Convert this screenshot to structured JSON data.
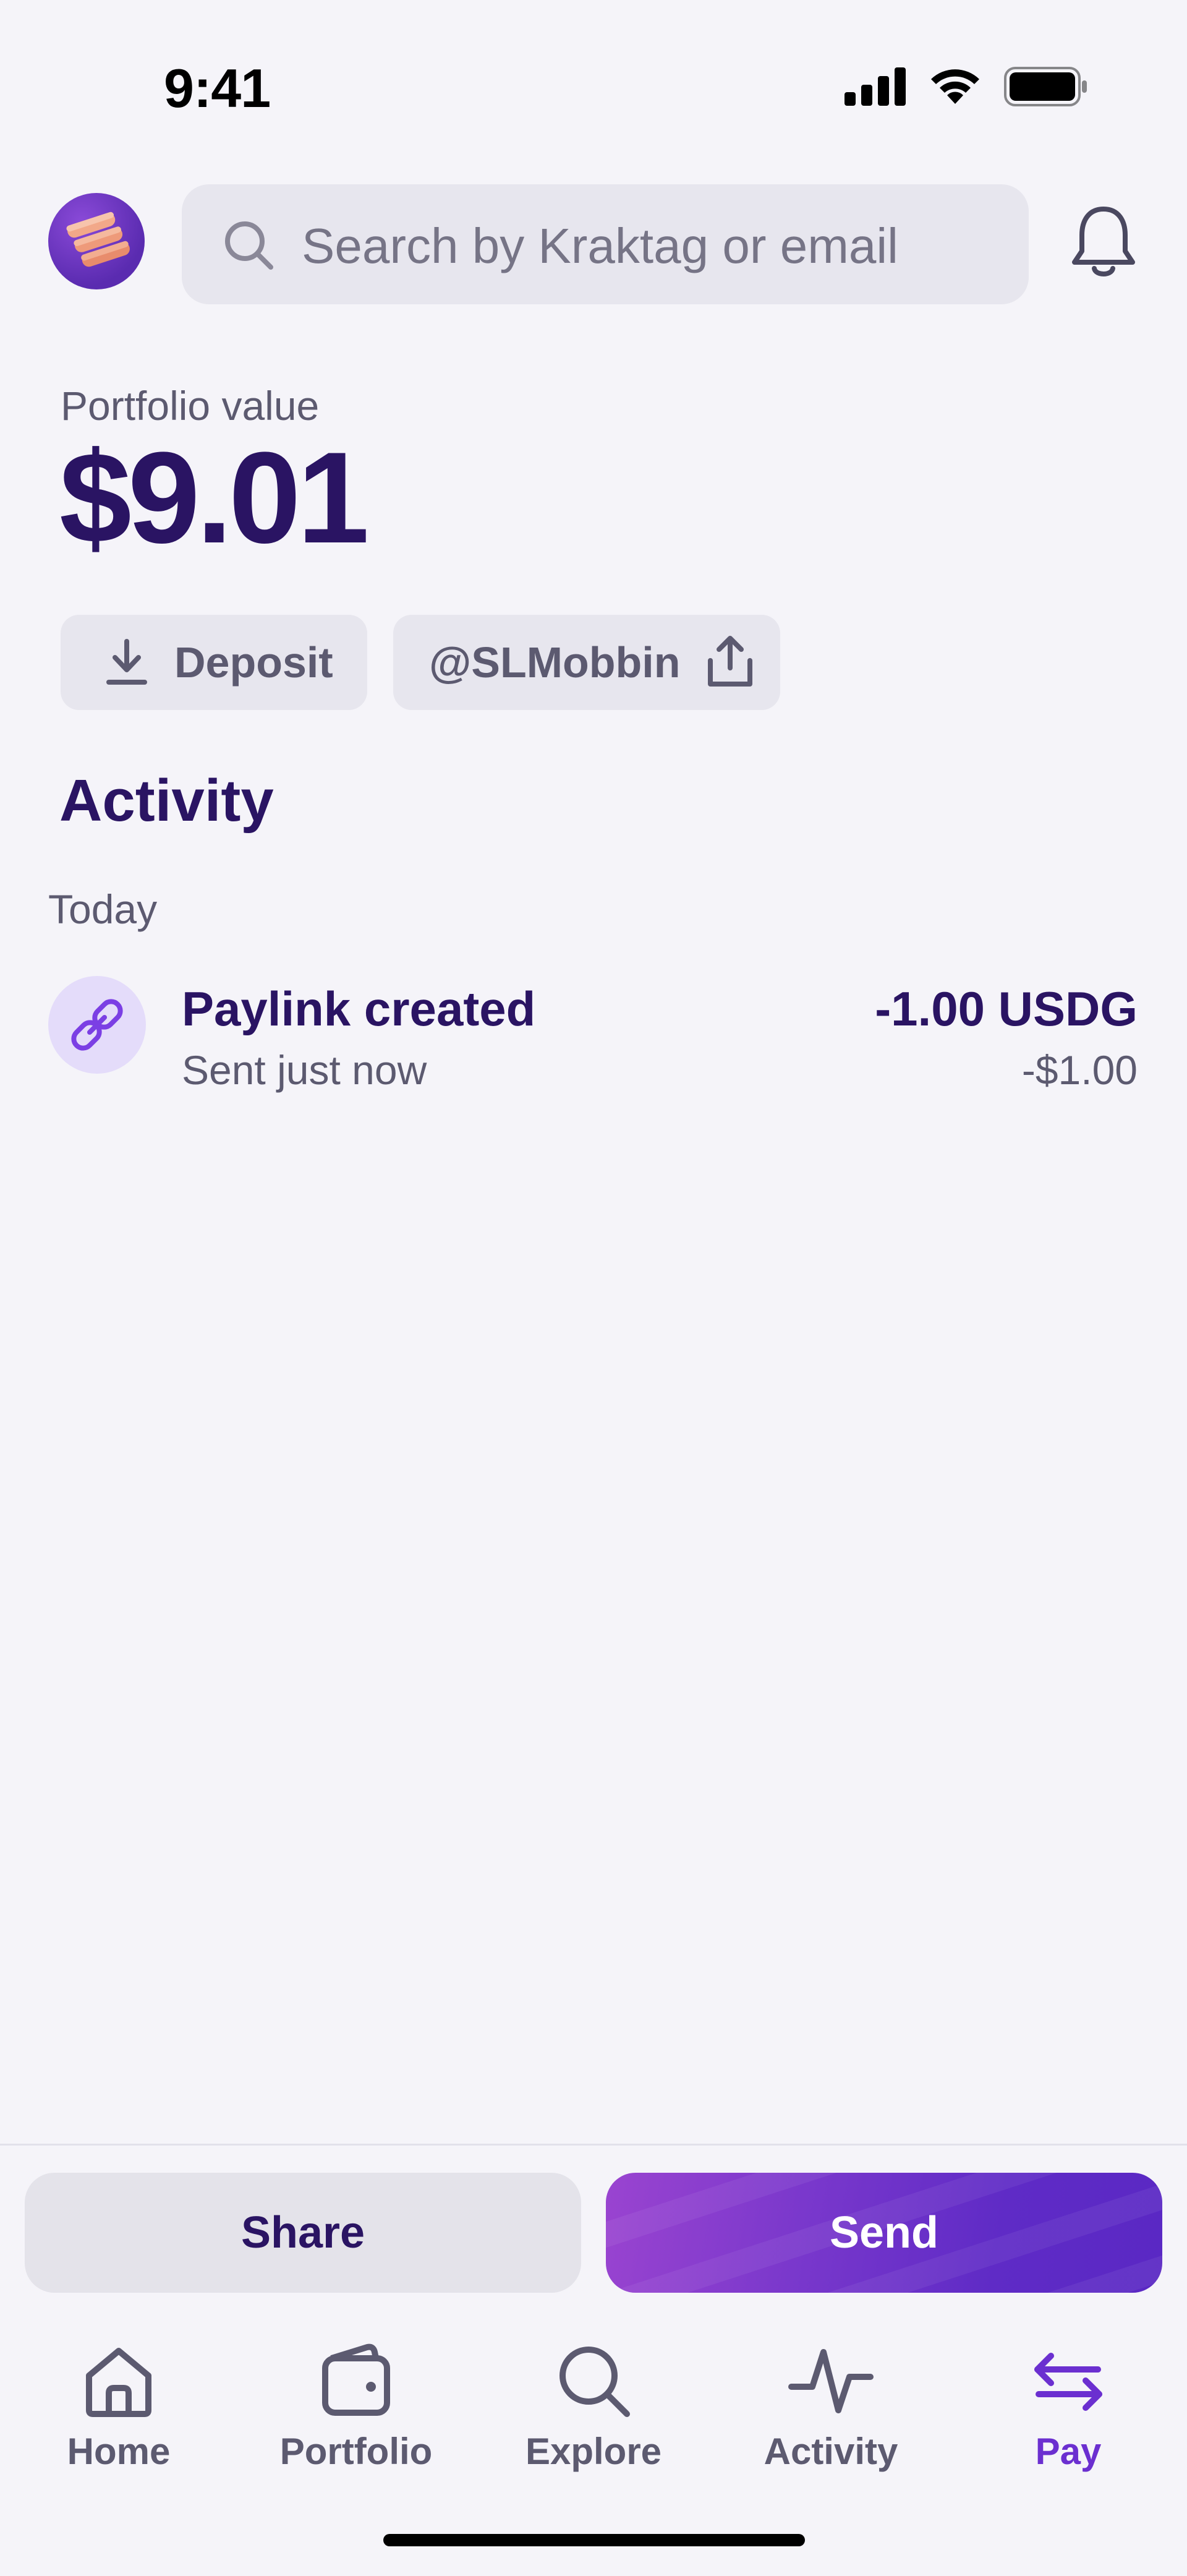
{
  "status_bar": {
    "time": "9:41"
  },
  "header": {
    "search_placeholder": "Search by Kraktag or email"
  },
  "portfolio": {
    "label": "Portfolio value",
    "value": "$9.01"
  },
  "actions": {
    "deposit_label": "Deposit",
    "handle_label": "@SLMobbin"
  },
  "activity": {
    "heading": "Activity",
    "groups": [
      {
        "label": "Today",
        "items": [
          {
            "title": "Paylink created",
            "subtitle": "Sent just now",
            "amount": "-1.00 USDG",
            "fiat": "-$1.00",
            "icon": "link-icon"
          }
        ]
      }
    ]
  },
  "bottom_actions": {
    "share_label": "Share",
    "send_label": "Send"
  },
  "tabs": [
    {
      "label": "Home",
      "icon": "home-icon",
      "active": false
    },
    {
      "label": "Portfolio",
      "icon": "wallet-icon",
      "active": false
    },
    {
      "label": "Explore",
      "icon": "search-icon",
      "active": false
    },
    {
      "label": "Activity",
      "icon": "pulse-icon",
      "active": false
    },
    {
      "label": "Pay",
      "icon": "transfer-icon",
      "active": true
    }
  ],
  "colors": {
    "brand": "#5f2bc6",
    "text_primary": "#2a1463",
    "text_secondary": "#5c5a70",
    "background": "#f5f4f9"
  }
}
